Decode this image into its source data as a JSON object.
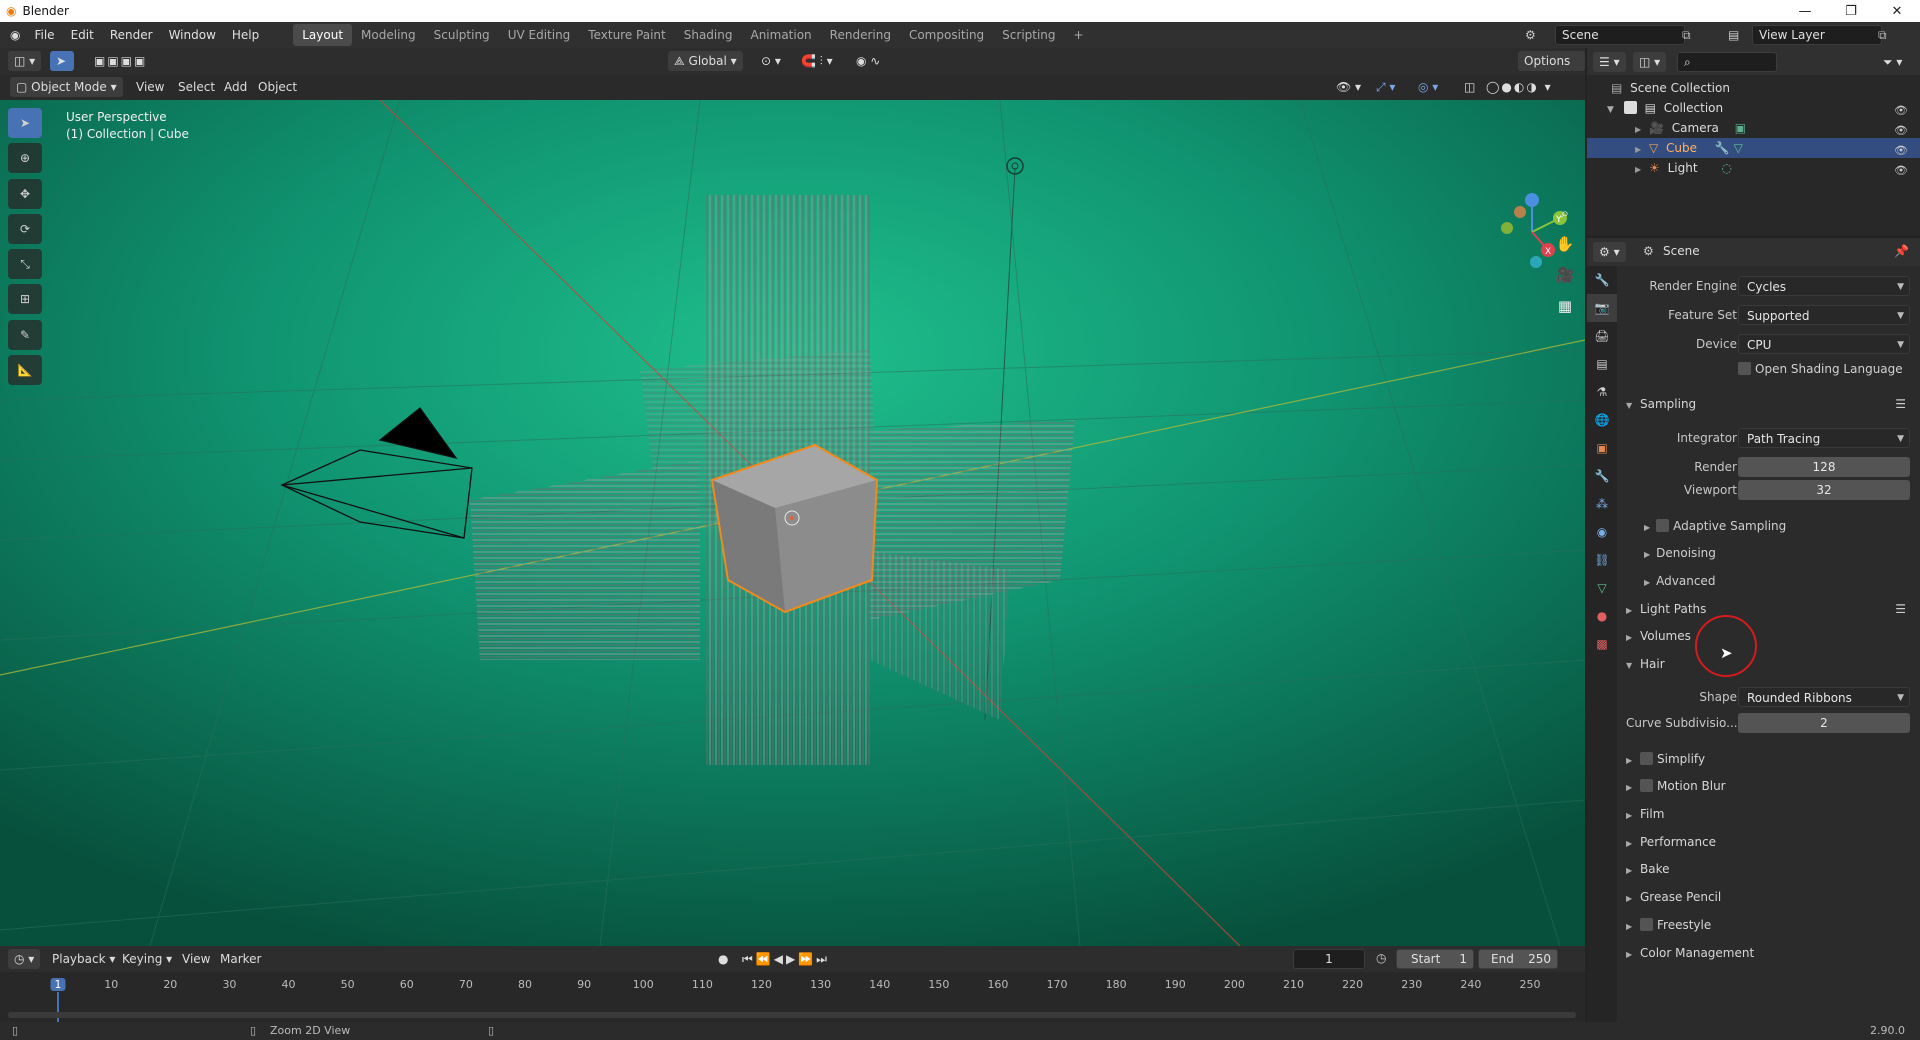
{
  "window": {
    "title": "Blender"
  },
  "menu": [
    "File",
    "Edit",
    "Render",
    "Window",
    "Help"
  ],
  "workspaces": {
    "tabs": [
      "Layout",
      "Modeling",
      "Sculpting",
      "UV Editing",
      "Texture Paint",
      "Shading",
      "Animation",
      "Rendering",
      "Compositing",
      "Scripting"
    ],
    "active": "Layout"
  },
  "scene_selector": {
    "scene": "Scene",
    "view_layer": "View Layer"
  },
  "tool_header": {
    "transform": "Global",
    "options": "Options"
  },
  "viewport_header": {
    "mode": "Object Mode",
    "menus": [
      "View",
      "Select",
      "Add",
      "Object"
    ]
  },
  "viewport": {
    "overlay_line1": "User Perspective",
    "overlay_line2": "(1) Collection | Cube",
    "bg_color": "#0f8a67"
  },
  "outliner": {
    "root": "Scene Collection",
    "collection": "Collection",
    "items": [
      {
        "label": "Camera",
        "selected": false
      },
      {
        "label": "Cube",
        "selected": true
      },
      {
        "label": "Light",
        "selected": false
      }
    ]
  },
  "properties": {
    "context": "Scene",
    "render_engine": {
      "label": "Render Engine",
      "value": "Cycles"
    },
    "feature_set": {
      "label": "Feature Set",
      "value": "Supported"
    },
    "device": {
      "label": "Device",
      "value": "CPU"
    },
    "osl": {
      "label": "Open Shading Language"
    },
    "sampling": {
      "title": "Sampling",
      "integrator": {
        "label": "Integrator",
        "value": "Path Tracing"
      },
      "render": {
        "label": "Render",
        "value": "128"
      },
      "viewport": {
        "label": "Viewport",
        "value": "32"
      },
      "subpanels": [
        "Adaptive Sampling",
        "Denoising",
        "Advanced"
      ]
    },
    "light_paths": "Light Paths",
    "volumes": "Volumes",
    "hair": {
      "title": "Hair",
      "shape": {
        "label": "Shape",
        "value": "Rounded Ribbons"
      },
      "curve_subdiv": {
        "label": "Curve Subdivisio...",
        "value": "2"
      }
    },
    "panels": [
      "Simplify",
      "Motion Blur",
      "Film",
      "Performance",
      "Bake",
      "Grease Pencil",
      "Freestyle",
      "Color Management"
    ]
  },
  "timeline": {
    "menus": [
      "Playback",
      "Keying",
      "View",
      "Marker"
    ],
    "current_frame": "1",
    "start_label": "Start",
    "start": "1",
    "end_label": "End",
    "end": "250",
    "ticks": [
      "1",
      "10",
      "20",
      "30",
      "40",
      "50",
      "60",
      "70",
      "80",
      "90",
      "100",
      "110",
      "120",
      "130",
      "140",
      "150",
      "160",
      "170",
      "180",
      "190",
      "200",
      "210",
      "220",
      "230",
      "240",
      "250"
    ]
  },
  "status": {
    "hint": "Zoom 2D View",
    "version": "2.90.0"
  }
}
